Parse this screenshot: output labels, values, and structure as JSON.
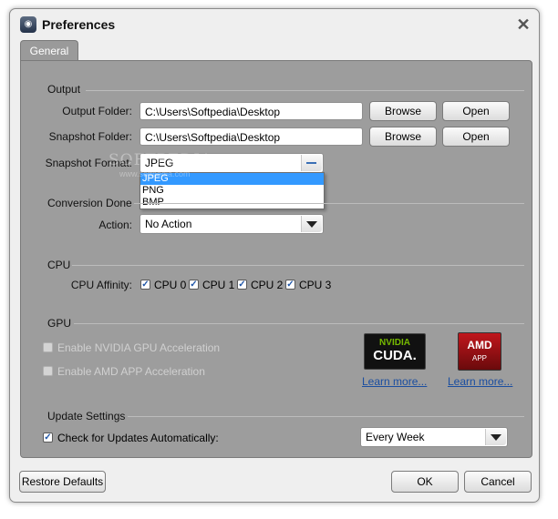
{
  "window": {
    "title": "Preferences"
  },
  "tabs": [
    {
      "label": "General"
    }
  ],
  "output": {
    "section_label": "Output",
    "output_folder_label": "Output Folder:",
    "output_folder_value": "C:\\Users\\Softpedia\\Desktop",
    "snapshot_folder_label": "Snapshot Folder:",
    "snapshot_folder_value": "C:\\Users\\Softpedia\\Desktop",
    "browse_label": "Browse",
    "open_label": "Open",
    "snapshot_format_label": "Snapshot Format:",
    "snapshot_format_value": "JPEG",
    "format_options": [
      "JPEG",
      "PNG",
      "BMP"
    ]
  },
  "conversion_done": {
    "section_label": "Conversion Done",
    "action_label": "Action:",
    "action_value": "No Action"
  },
  "cpu": {
    "section_label": "CPU",
    "affinity_label": "CPU Affinity:",
    "cores": [
      {
        "label": "CPU 0",
        "checked": true
      },
      {
        "label": "CPU 1",
        "checked": true
      },
      {
        "label": "CPU 2",
        "checked": true
      },
      {
        "label": "CPU 3",
        "checked": true
      }
    ]
  },
  "gpu": {
    "section_label": "GPU",
    "nvidia_label": "Enable NVIDIA GPU Acceleration",
    "amd_label": "Enable AMD APP Acceleration",
    "nvidia_logo_top": "NVIDIA",
    "nvidia_logo_bottom": "CUDA.",
    "amd_logo_top": "AMD",
    "amd_logo_bottom": "APP",
    "learn_more_nvidia": "Learn more...",
    "learn_more_amd": "Learn more..."
  },
  "update_settings": {
    "section_label": "Update Settings",
    "check_label": "Check for Updates Automatically:",
    "checked": true,
    "frequency_value": "Every Week"
  },
  "footer": {
    "restore_defaults_label": "Restore Defaults",
    "ok_label": "OK",
    "cancel_label": "Cancel"
  },
  "watermark": {
    "text": "SOFTPEDIA",
    "url": "www.softpedia.com"
  },
  "colors": {
    "panel": "#9d9d9d",
    "selection": "#3399ff",
    "link": "#1b4ea0"
  }
}
